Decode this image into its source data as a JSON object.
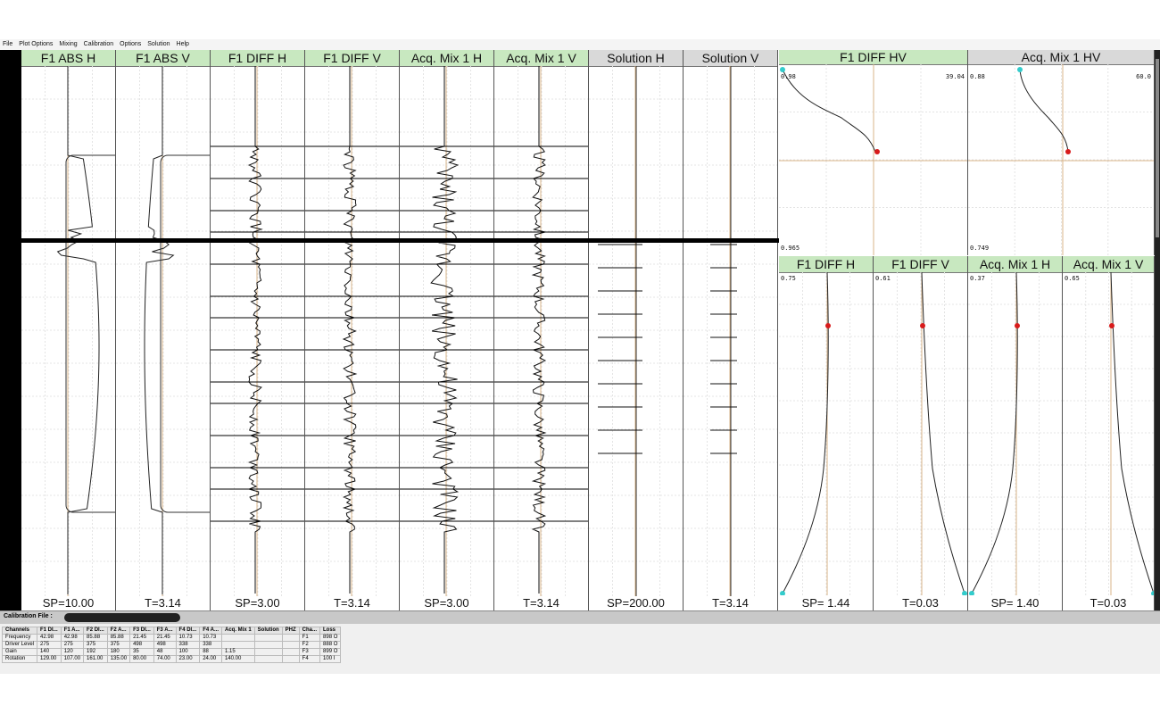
{
  "menu": [
    "File",
    "Plot Options",
    "Mixing",
    "Calibration",
    "Options",
    "Solution",
    "Help"
  ],
  "strips": [
    {
      "title": "F1  ABS H",
      "footer": "SP=10.00",
      "active": true
    },
    {
      "title": "F1  ABS V",
      "footer": "T=3.14",
      "active": true
    },
    {
      "title": "F1 DIFF H",
      "footer": "SP=3.00",
      "active": true
    },
    {
      "title": "F1 DIFF V",
      "footer": "T=3.14",
      "active": true
    },
    {
      "title": "Acq. Mix 1 H",
      "footer": "SP=3.00",
      "active": true
    },
    {
      "title": "Acq. Mix 1 V",
      "footer": "T=3.14",
      "active": true
    },
    {
      "title": "Solution H",
      "footer": "SP=200.00",
      "active": false
    },
    {
      "title": "Solution V",
      "footer": "T=3.14",
      "active": false
    }
  ],
  "hv": [
    {
      "title": "F1 DIFF HV",
      "top_left": "0.98",
      "top_right": "39.04",
      "bottom_left": "0.965",
      "active": true
    },
    {
      "title": "Acq. Mix 1 HV",
      "top_left": "0.88",
      "top_right": "60.0",
      "bottom_left": "0.749",
      "active": false
    }
  ],
  "vplots": [
    {
      "title": "F1 DIFF H",
      "corner": "0.75",
      "footer": "SP= 1.44"
    },
    {
      "title": "F1 DIFF V",
      "corner": "0.61",
      "footer": "T=0.03"
    },
    {
      "title": "Acq. Mix 1 H",
      "corner": "0.37",
      "footer": "SP= 1.40"
    },
    {
      "title": "Acq. Mix 1 V",
      "corner": "0.65",
      "footer": "T=0.03"
    }
  ],
  "calibration": {
    "label": "Calibration File :",
    "headers": [
      "Channels",
      "F1 DI...",
      "F1 A...",
      "F2 DI...",
      "F2 A...",
      "F3 DI...",
      "F3 A...",
      "F4 DI...",
      "F4 A...",
      "Acq. Mix 1",
      "Solution",
      "PHZ",
      "Cha...",
      "Loss"
    ],
    "rows": [
      [
        "Frequency",
        "42.98",
        "42.98",
        "85.88",
        "85.88",
        "21.45",
        "21.45",
        "10.73",
        "10.73",
        "",
        "",
        "",
        "F1",
        "898  O"
      ],
      [
        "Driver Level",
        "275",
        "275",
        "375",
        "375",
        "498",
        "498",
        "338",
        "338",
        "",
        "",
        "",
        "F2",
        "888  O"
      ],
      [
        "Gain",
        "140",
        "120",
        "192",
        "180",
        "35",
        "48",
        "100",
        "88",
        "1.15",
        "",
        "",
        "F3",
        "899  O"
      ],
      [
        "Rotation",
        "129.00",
        "107.00",
        "161.00",
        "135.00",
        "80.00",
        "74.00",
        "23.00",
        "24.00",
        "140.00",
        "",
        "",
        "F4",
        "100  I"
      ]
    ]
  }
}
